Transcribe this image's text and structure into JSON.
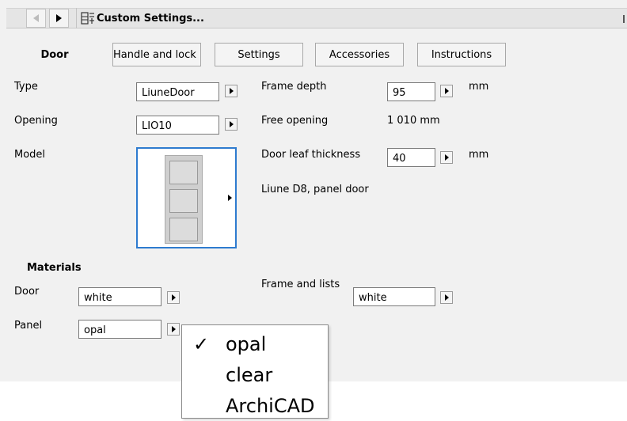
{
  "window": {
    "title": "Custom Settings..."
  },
  "tabs": {
    "active": "Door",
    "items": [
      "Handle and lock",
      "Settings",
      "Accessories",
      "Instructions"
    ]
  },
  "form": {
    "type_label": "Type",
    "type_value": "LiuneDoor",
    "opening_label": "Opening",
    "opening_value": "LIO10",
    "model_label": "Model",
    "frame_depth_label": "Frame depth",
    "frame_depth_value": "95",
    "frame_depth_unit": "mm",
    "free_opening_label": "Free opening",
    "free_opening_value": "1 010 mm",
    "leaf_thickness_label": "Door leaf thickness",
    "leaf_thickness_value": "40",
    "leaf_thickness_unit": "mm",
    "model_description": "Liune D8, panel door"
  },
  "materials": {
    "section_title": "Materials",
    "door_label": "Door",
    "door_value": "white",
    "panel_label": "Panel",
    "panel_value": "opal",
    "frame_label": "Frame and lists",
    "frame_value": "white"
  },
  "dropdown": {
    "options": [
      "opal",
      "clear",
      "ArchiCAD"
    ],
    "selected": "opal",
    "check_glyph": "✓"
  },
  "icons": {
    "back": "chevron-left-icon",
    "forward": "chevron-right-icon",
    "settings": "custom-settings-icon"
  }
}
